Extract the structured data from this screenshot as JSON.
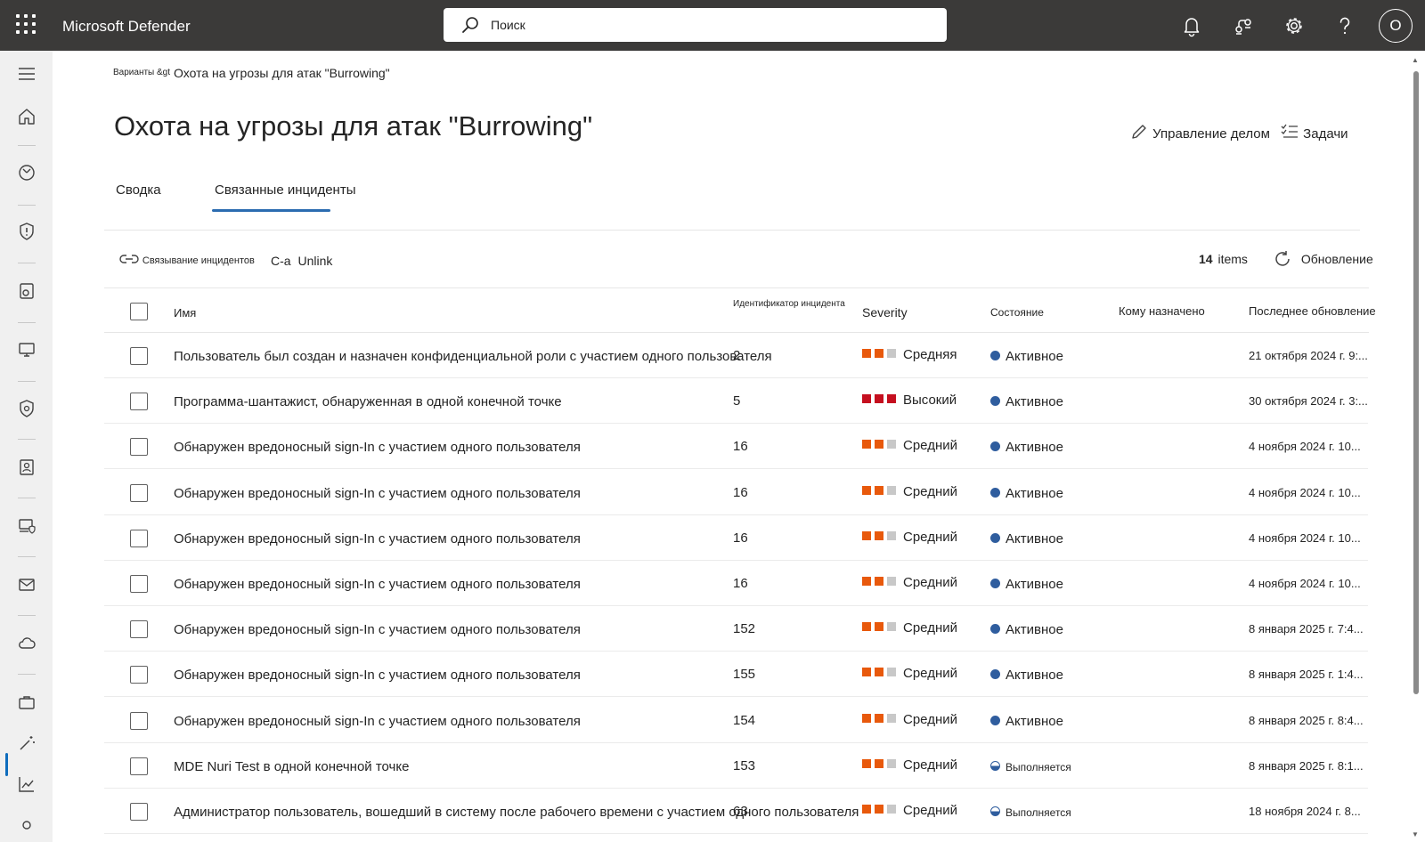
{
  "app": {
    "title": "Microsoft Defender",
    "user_initial": "O"
  },
  "search": {
    "placeholder": "Поиск"
  },
  "topbar_icons": [
    "bell-icon",
    "share-icon",
    "gear-icon",
    "help-icon"
  ],
  "breadcrumb": {
    "parent": "Варианты &gt",
    "current": "Охота на угрозы для атак \"Burrowing\""
  },
  "page": {
    "title": "Охота на угрозы для атак \"Burrowing\"",
    "manage_case": "Управление делом",
    "tasks": "Задачи"
  },
  "tabs": [
    {
      "label": "Сводка",
      "active": false
    },
    {
      "label": "Связанные инциденты",
      "active": true
    }
  ],
  "toolbar": {
    "link_incidents": "Связывание инцидентов",
    "unlink_prefix": "C-a",
    "unlink": "Unlink",
    "items_count": "14",
    "items_label": "items",
    "refresh": "Обновление"
  },
  "table": {
    "columns": {
      "name": "Имя",
      "incident_id": "Идентификатор инцидента",
      "severity": "Severity",
      "status": "Состояние",
      "assigned": "Кому назначено",
      "last_update": "Последнее обновление"
    },
    "severity_colors": {
      "on_medium": "#e8590c",
      "on_high": "#c50f1f",
      "off": "#c8c8c8"
    },
    "status_color": "#2f5d9e",
    "rows": [
      {
        "name": "Пользователь был создан и назначен конфиденциальной роли с участием одного пользователя",
        "id": "2",
        "severity": "Средняя",
        "level": "medium",
        "status": "Активное",
        "status_type": "active",
        "date": "21 октября 2024 г. 9:..."
      },
      {
        "name": "Программа-шантажист, обнаруженная в одной конечной точке",
        "id": "5",
        "severity": "Высокий",
        "level": "high",
        "status": "Активное",
        "status_type": "active",
        "date": "30 октября 2024 г. 3:..."
      },
      {
        "name": "Обнаружен вредоносный sign-In с участием одного пользователя",
        "id": "16",
        "severity": "Средний",
        "level": "medium",
        "status": "Активное",
        "status_type": "active",
        "date": "4 ноября 2024 г. 10..."
      },
      {
        "name": "Обнаружен вредоносный sign-In с участием одного пользователя",
        "id": "16",
        "severity": "Средний",
        "level": "medium",
        "status": "Активное",
        "status_type": "active",
        "date": "4 ноября 2024 г. 10..."
      },
      {
        "name": "Обнаружен вредоносный sign-In с участием одного пользователя",
        "id": "16",
        "severity": "Средний",
        "level": "medium",
        "status": "Активное",
        "status_type": "active",
        "date": "4 ноября 2024 г. 10..."
      },
      {
        "name": "Обнаружен вредоносный sign-In с участием одного пользователя",
        "id": "16",
        "severity": "Средний",
        "level": "medium",
        "status": "Активное",
        "status_type": "active",
        "date": "4 ноября 2024 г. 10..."
      },
      {
        "name": "Обнаружен вредоносный sign-In с участием одного пользователя",
        "id": "152",
        "severity": "Средний",
        "level": "medium",
        "status": "Активное",
        "status_type": "active",
        "date": "8 января 2025 г. 7:4..."
      },
      {
        "name": "Обнаружен вредоносный sign-In с участием одного пользователя",
        "id": "155",
        "severity": "Средний",
        "level": "medium",
        "status": "Активное",
        "status_type": "active",
        "date": "8 января 2025 г. 1:4..."
      },
      {
        "name": "Обнаружен вредоносный sign-In с участием одного пользователя",
        "id": "154",
        "severity": "Средний",
        "level": "medium",
        "status": "Активное",
        "status_type": "active",
        "date": "8 января 2025 г. 8:4..."
      },
      {
        "name": "MDE Nuri Test в одной конечной точке",
        "id": "153",
        "severity": "Средний",
        "level": "medium",
        "status": "Выполняется",
        "status_type": "progress",
        "date": "8 января 2025 г. 8:1..."
      },
      {
        "name": "Администратор пользователь, вошедший в систему после рабочего времени с участием одного пользователя",
        "id": "63",
        "severity": "Средний",
        "level": "medium",
        "status": "Выполняется",
        "status_type": "progress",
        "date": "18 ноября 2024 г. 8..."
      }
    ]
  }
}
